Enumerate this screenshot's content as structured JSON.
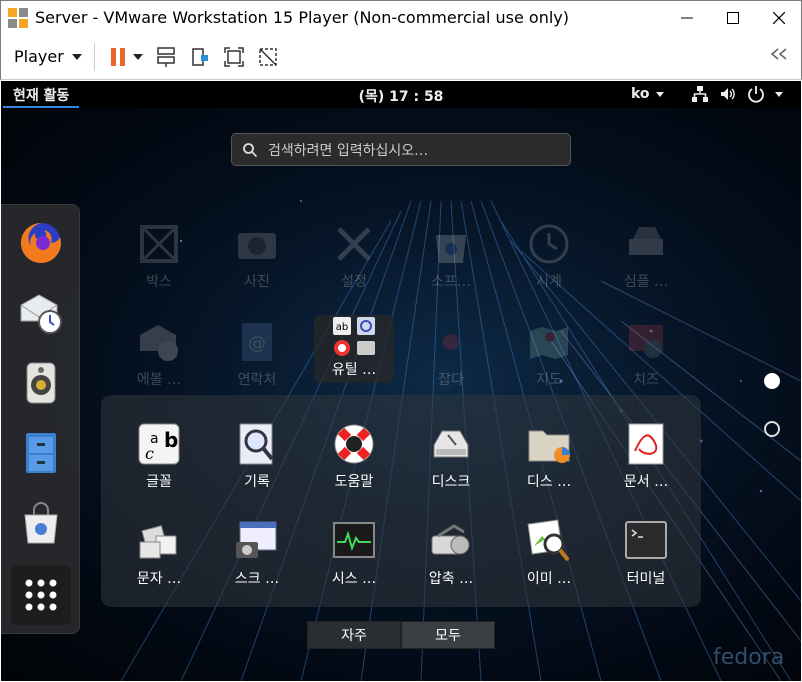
{
  "window": {
    "title": "Server - VMware Workstation 15 Player (Non-commercial use only)"
  },
  "toolbar": {
    "player_label": "Player"
  },
  "gnome": {
    "activities": "현재 활동",
    "clock": "(목) 17 : 58",
    "lang": "ko",
    "search_placeholder": "검색하려면 입력하십시오…"
  },
  "background_apps": [
    {
      "label": "박스"
    },
    {
      "label": "사진"
    },
    {
      "label": "설정"
    },
    {
      "label": "소프…"
    },
    {
      "label": "시계"
    },
    {
      "label": "심플 …"
    },
    {
      "label": "에볼 …"
    },
    {
      "label": "연락처"
    },
    {
      "label": "유틸 …"
    },
    {
      "label": "잡다"
    },
    {
      "label": "지도"
    },
    {
      "label": "치즈"
    }
  ],
  "folder_apps": [
    {
      "label": "글꼴"
    },
    {
      "label": "기록"
    },
    {
      "label": "도움말"
    },
    {
      "label": "디스크"
    },
    {
      "label": "디스 …"
    },
    {
      "label": "문서 …"
    },
    {
      "label": "문자 …"
    },
    {
      "label": "스크 …"
    },
    {
      "label": "시스 …"
    },
    {
      "label": "압축 …"
    },
    {
      "label": "이미 …"
    },
    {
      "label": "터미널"
    }
  ],
  "view_switch": {
    "frequent": "자주",
    "all": "모두"
  },
  "brand": "fedora"
}
